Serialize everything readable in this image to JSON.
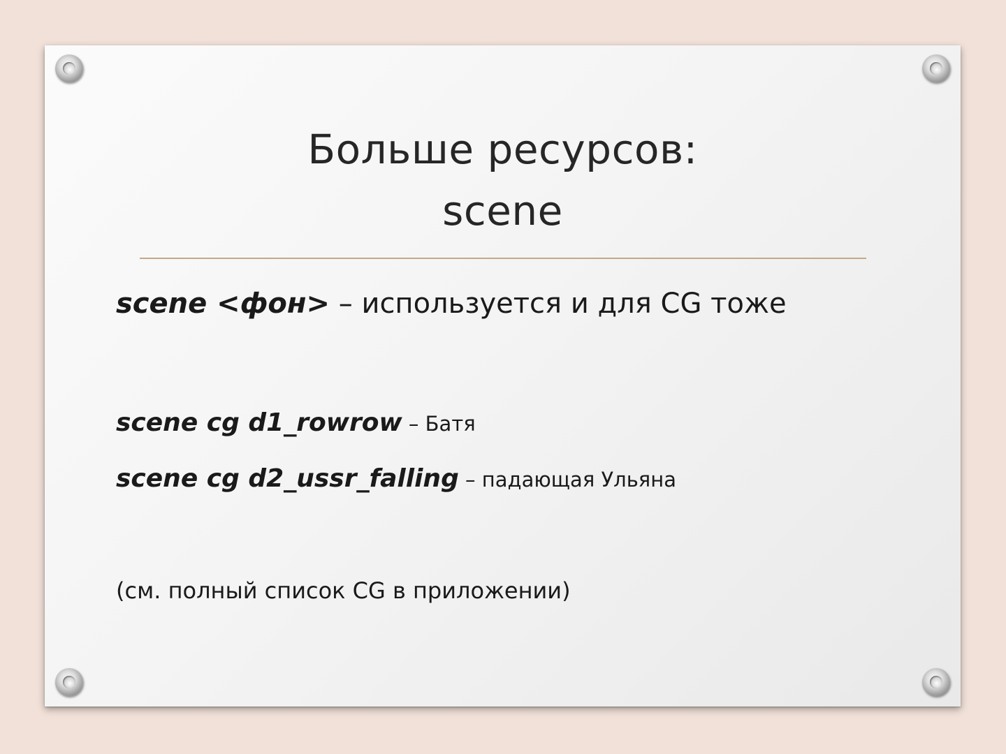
{
  "slide": {
    "title_line1": "Больше ресурсов:",
    "title_line2": "scene",
    "items": [
      {
        "code": "scene <фон>",
        "desc": " – используется и для CG тоже"
      },
      {
        "code": "scene cg d1_rowrow",
        "desc": " – Батя"
      },
      {
        "code": "scene cg d2_ussr_falling",
        "desc": " – падающая Ульяна"
      }
    ],
    "note": "(см. полный список CG в приложении)"
  },
  "colors": {
    "background": "#f1e1d9",
    "slide": "#f4f4f4",
    "rule": "#c2a98a",
    "text": "#1a1a1a"
  }
}
